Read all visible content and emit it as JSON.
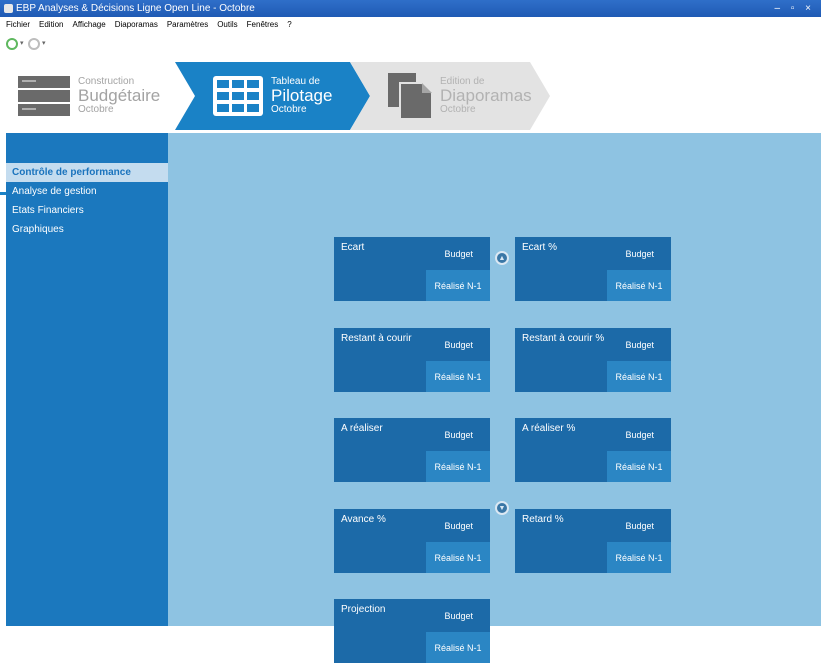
{
  "window": {
    "title": "EBP Analyses & Décisions Ligne Open Line - Octobre",
    "controls": "– ▫ ×"
  },
  "menu": [
    "Fichier",
    "Edition",
    "Affichage",
    "Diaporamas",
    "Paramètres",
    "Outils",
    "Fenêtres",
    "?"
  ],
  "nav": {
    "caret": "▾"
  },
  "steps": [
    {
      "line1": "Construction",
      "line2": "Budgétaire",
      "line3": "Octobre",
      "state": "inactive"
    },
    {
      "line1": "Tableau de",
      "line2": "Pilotage",
      "line3": "Octobre",
      "state": "active"
    },
    {
      "line1": "Edition de",
      "line2": "Diaporamas",
      "line3": "Octobre",
      "state": "inactive"
    }
  ],
  "toolbar_icons": [
    "report-icon",
    "settings-gears-icon"
  ],
  "sidebar": {
    "items": [
      {
        "label": "Contrôle de performance",
        "active": true
      },
      {
        "label": "Analyse de gestion",
        "active": false
      },
      {
        "label": "Etats Financiers",
        "active": false
      },
      {
        "label": "Graphiques",
        "active": false
      }
    ]
  },
  "cards": [
    {
      "title": "Ecart",
      "budget": "Budget",
      "realise": "Réalisé N-1"
    },
    {
      "title": "Ecart %",
      "budget": "Budget",
      "realise": "Réalisé N-1"
    },
    {
      "title": "Restant à courir",
      "budget": "Budget",
      "realise": "Réalisé N-1"
    },
    {
      "title": "Restant à courir %",
      "budget": "Budget",
      "realise": "Réalisé N-1"
    },
    {
      "title": "A réaliser",
      "budget": "Budget",
      "realise": "Réalisé N-1"
    },
    {
      "title": "A réaliser %",
      "budget": "Budget",
      "realise": "Réalisé N-1"
    },
    {
      "title": "Avance %",
      "budget": "Budget",
      "realise": "Réalisé N-1"
    },
    {
      "title": "Retard %",
      "budget": "Budget",
      "realise": "Réalisé N-1"
    },
    {
      "title": "Projection",
      "budget": "Budget",
      "realise": "Réalisé N-1"
    }
  ],
  "scroll": {
    "up": "▲",
    "down": "▼"
  },
  "colors": {
    "sidebar": "#1b78be",
    "main_bg": "#8ec3e2",
    "card": "#1c6aa8",
    "card_realise": "#2b86c4",
    "active_step": "#1a82c6"
  }
}
